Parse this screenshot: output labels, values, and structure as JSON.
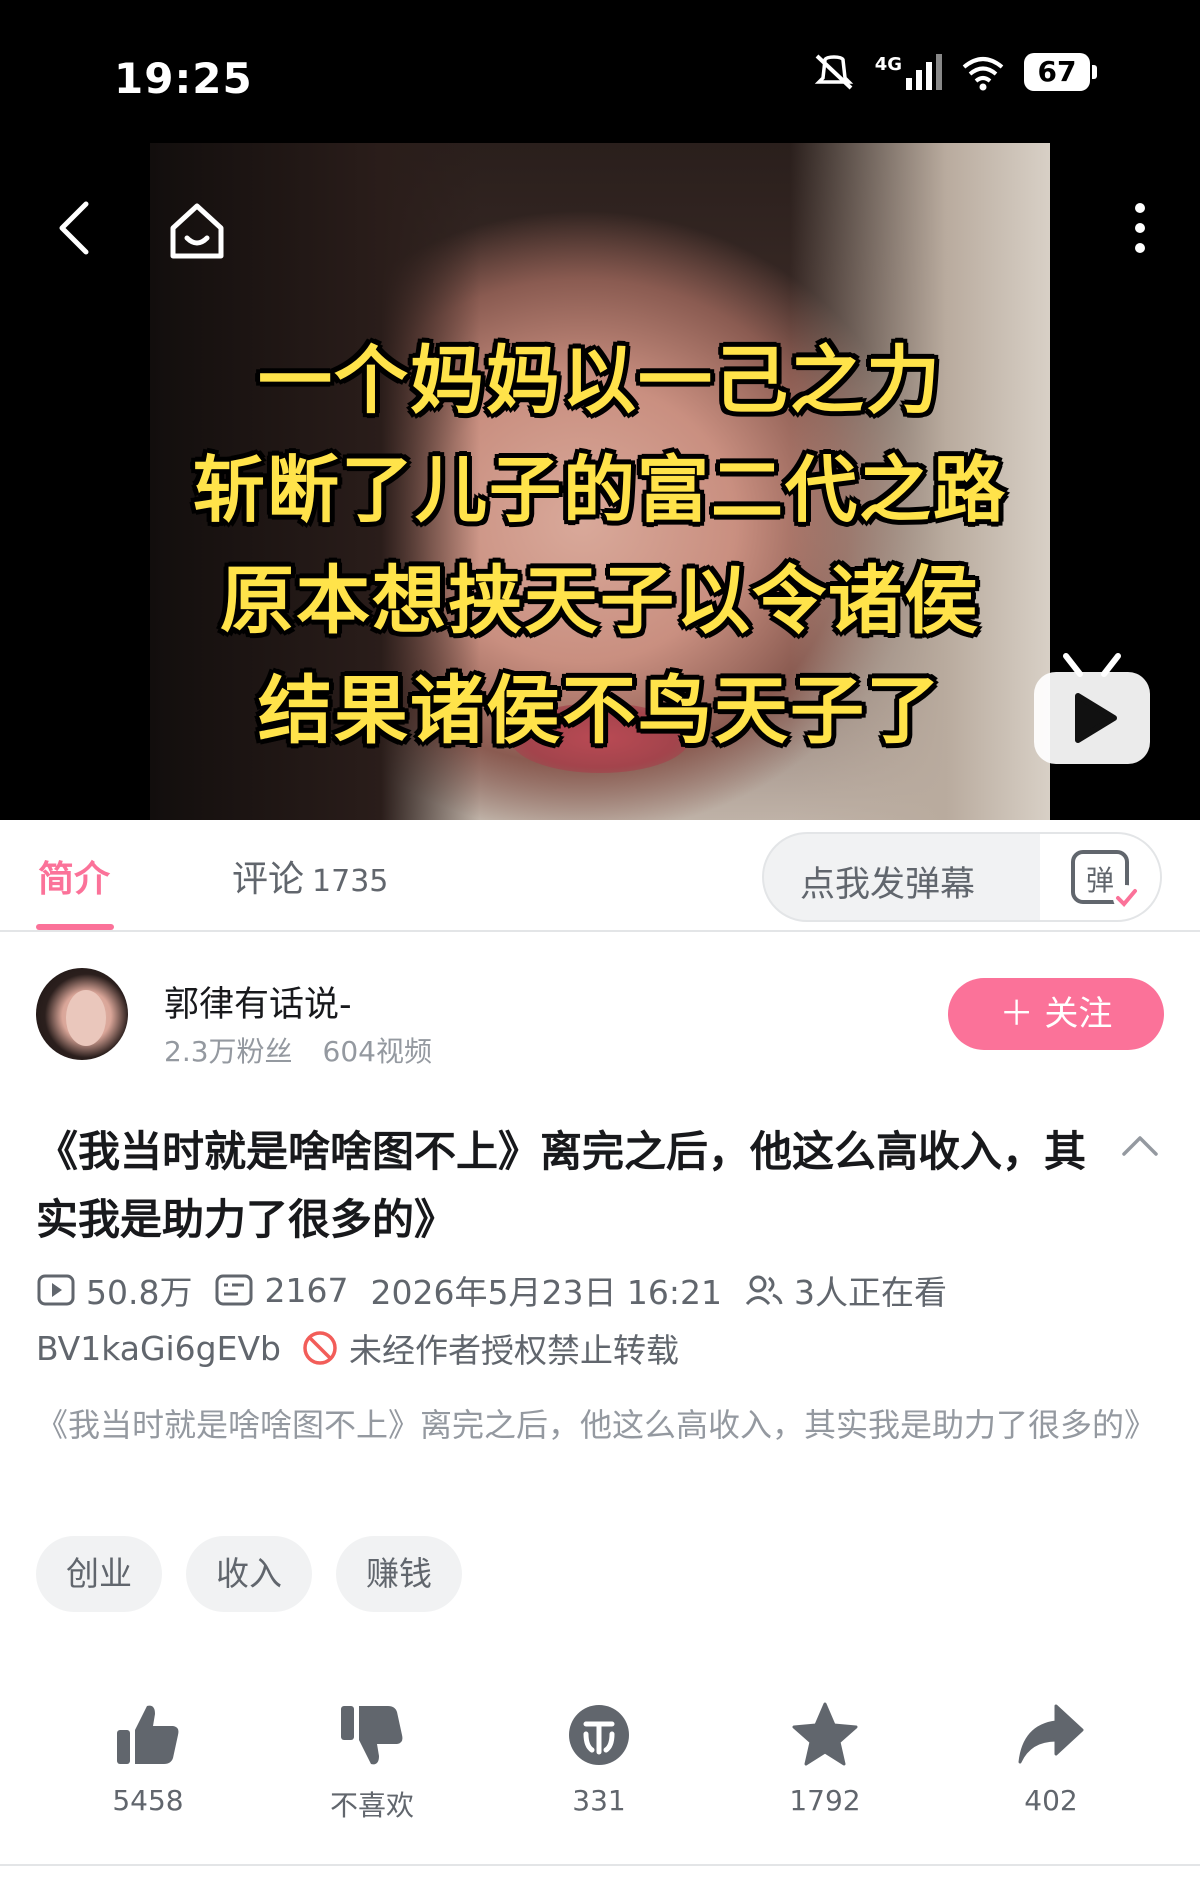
{
  "status_bar": {
    "time": "19:25",
    "network": "4G",
    "battery": "67"
  },
  "video": {
    "caption_lines": [
      "一个妈妈以一己之力",
      "斩断了儿子的富二代之路",
      "原本想挟天子以令诸侯",
      "结果诸侯不鸟天子了"
    ]
  },
  "tabs": {
    "intro": "简介",
    "comments": "评论",
    "comments_count": "1735",
    "danmaku_placeholder": "点我发弹幕",
    "danmaku_icon_char": "弹"
  },
  "uploader": {
    "name": "郭律有话说-",
    "followers": "2.3万粉丝",
    "videos": "604视频",
    "follow_label": "＋ 关注"
  },
  "video_info": {
    "title": "《我当时就是啥啥图不上》离完之后，他这么高收入，其实我是助力了很多的》",
    "views": "50.8万",
    "danmaku_count": "2167",
    "publish_time": "2026年5月23日 16:21",
    "watching": "3人正在看",
    "bvid": "BV1kaGi6gEVb",
    "copyright": "未经作者授权禁止转载",
    "description": "《我当时就是啥啥图不上》离完之后，他这么高收入，其实我是助力了很多的》"
  },
  "tags": [
    "创业",
    "收入",
    "赚钱"
  ],
  "actions": {
    "like": "5458",
    "dislike": "不喜欢",
    "coin": "331",
    "favorite": "1792",
    "share": "402"
  },
  "colors": {
    "accent": "#fb7299",
    "caption": "#ffe34a",
    "icon_gray": "#61666d"
  }
}
